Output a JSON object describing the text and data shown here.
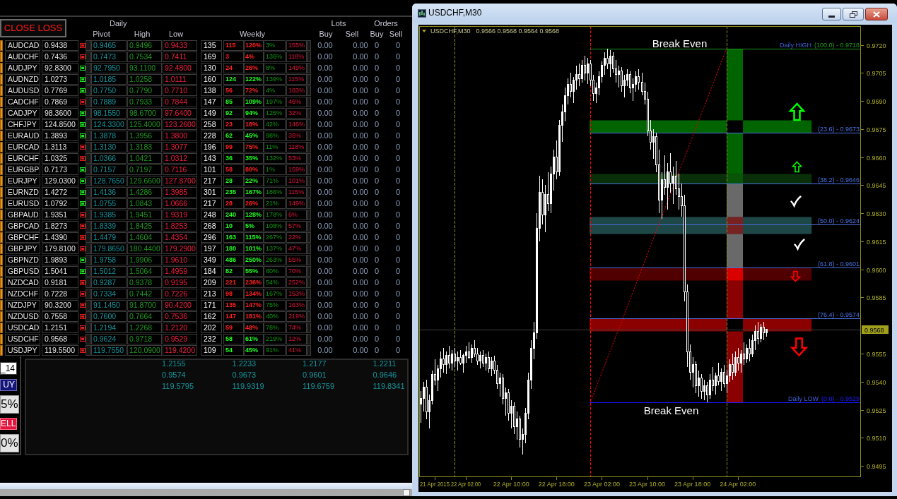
{
  "left_panel": {
    "close_loss_button": "CLOSE LOSS",
    "header": {
      "daily": "Daily",
      "pivot": "Pivot",
      "high": "High",
      "low": "Low",
      "weekly": "Weekly",
      "lots": "Lots",
      "orders": "Orders",
      "lots_buy": "Buy",
      "lots_sell": "Sell",
      "orders_buy": "Buy",
      "orders_sell": "Sell"
    },
    "rows": [
      {
        "symbol": "AUDCAD",
        "price": "0.9438",
        "signal": {
          "color": "#e01b1b"
        },
        "pivot": "0.9465",
        "high": "0.9496",
        "low": "0.9433",
        "weekly": {
          "values": [
            "135",
            "115",
            "120%",
            "3%",
            "155%"
          ],
          "color": "#ff2020"
        },
        "lots": [
          "0.00",
          "0.00"
        ],
        "orders": [
          "0",
          "0"
        ]
      },
      {
        "symbol": "AUDCHF",
        "price": "0.7436",
        "signal": {
          "color": "#e01b1b"
        },
        "pivot": "0.7473",
        "high": "0.7534",
        "low": "0.7411",
        "weekly": {
          "values": [
            "169",
            "3",
            "4%",
            "136%",
            "118%"
          ],
          "color": "#ff2020"
        },
        "lots": [
          "0.00",
          "0.00"
        ],
        "orders": [
          "0",
          "0"
        ]
      },
      {
        "symbol": "AUDJPY",
        "price": "92.8300",
        "signal": {
          "color": "#19e019"
        },
        "pivot": "92.7950",
        "high": "93.1100",
        "low": "92.4800",
        "weekly": {
          "values": [
            "130",
            "24",
            "26%",
            "8%",
            "149%"
          ],
          "color": "#ff2020"
        },
        "lots": [
          "0.00",
          "0.00"
        ],
        "orders": [
          "0",
          "0"
        ]
      },
      {
        "symbol": "AUDNZD",
        "price": "1.0273",
        "signal": {
          "color": "#19e019"
        },
        "pivot": "1.0185",
        "high": "1.0258",
        "low": "1.0111",
        "weekly": {
          "values": [
            "160",
            "124",
            "122%",
            "139%",
            "115%"
          ],
          "color": "#20ff20"
        },
        "lots": [
          "0.00",
          "0.00"
        ],
        "orders": [
          "0",
          "0"
        ]
      },
      {
        "symbol": "AUDUSD",
        "price": "0.7769",
        "signal": {
          "color": "#19e019"
        },
        "pivot": "0.7750",
        "high": "0.7790",
        "low": "0.7710",
        "weekly": {
          "values": [
            "138",
            "56",
            "72%",
            "4%",
            "183%"
          ],
          "color": "#ff2020"
        },
        "lots": [
          "0.00",
          "0.00"
        ],
        "orders": [
          "0",
          "0"
        ]
      },
      {
        "symbol": "CADCHF",
        "price": "0.7869",
        "signal": {
          "color": "#e01b1b"
        },
        "pivot": "0.7889",
        "high": "0.7933",
        "low": "0.7844",
        "weekly": {
          "values": [
            "147",
            "85",
            "109%",
            "197%",
            "46%"
          ],
          "color": "#20ff20"
        },
        "lots": [
          "0.00",
          "0.00"
        ],
        "orders": [
          "0",
          "0"
        ]
      },
      {
        "symbol": "CADJPY",
        "price": "98.3600",
        "signal": {
          "color": "#19e019"
        },
        "pivot": "98.1550",
        "high": "98.6700",
        "low": "97.6400",
        "weekly": {
          "values": [
            "149",
            "92",
            "94%",
            "126%",
            "32%"
          ],
          "color": "#20ff20"
        },
        "lots": [
          "0.00",
          "0.00"
        ],
        "orders": [
          "0",
          "0"
        ]
      },
      {
        "symbol": "CHFJPY",
        "price": "124.8500",
        "signal": {
          "color": "#19e019"
        },
        "pivot": "124.3300",
        "high": "125.4000",
        "low": "123.2600",
        "weekly": {
          "values": [
            "258",
            "23",
            "18%",
            "42%",
            "146%"
          ],
          "color": "#ff2020"
        },
        "lots": [
          "0.00",
          "0.00"
        ],
        "orders": [
          "0",
          "0"
        ]
      },
      {
        "symbol": "EURAUD",
        "price": "1.3893",
        "signal": {
          "color": "#19e019"
        },
        "pivot": "1.3878",
        "high": "1.3956",
        "low": "1.3800",
        "weekly": {
          "values": [
            "228",
            "62",
            "45%",
            "98%",
            "35%"
          ],
          "color": "#20ff20"
        },
        "lots": [
          "0.00",
          "0.00"
        ],
        "orders": [
          "0",
          "0"
        ]
      },
      {
        "symbol": "EURCAD",
        "price": "1.3113",
        "signal": {
          "color": "#e01b1b"
        },
        "pivot": "1.3130",
        "high": "1.3183",
        "low": "1.3077",
        "weekly": {
          "values": [
            "196",
            "99",
            "75%",
            "11%",
            "118%"
          ],
          "color": "#ff2020"
        },
        "lots": [
          "0.00",
          "0.00"
        ],
        "orders": [
          "0",
          "0"
        ]
      },
      {
        "symbol": "EURCHF",
        "price": "1.0325",
        "signal": {
          "color": "#e01b1b"
        },
        "pivot": "1.0366",
        "high": "1.0421",
        "low": "1.0312",
        "weekly": {
          "values": [
            "143",
            "36",
            "35%",
            "132%",
            "53%"
          ],
          "color": "#20ff20"
        },
        "lots": [
          "0.00",
          "0.00"
        ],
        "orders": [
          "0",
          "0"
        ]
      },
      {
        "symbol": "EURGBP",
        "price": "0.7173",
        "signal": {
          "color": "#19e019"
        },
        "pivot": "0.7157",
        "high": "0.7197",
        "low": "0.7116",
        "weekly": {
          "values": [
            "101",
            "58",
            "80%",
            "1%",
            "159%"
          ],
          "color": "#ff2020"
        },
        "lots": [
          "0.00",
          "0.00"
        ],
        "orders": [
          "0",
          "0"
        ]
      },
      {
        "symbol": "EURJPY",
        "price": "129.0300",
        "signal": {
          "color": "#19e019"
        },
        "pivot": "128.7650",
        "high": "129.6600",
        "low": "127.8700",
        "weekly": {
          "values": [
            "217",
            "28",
            "22%",
            "71%",
            "101%"
          ],
          "color": "#20ff20"
        },
        "lots": [
          "0.00",
          "0.00"
        ],
        "orders": [
          "0",
          "0"
        ]
      },
      {
        "symbol": "EURNZD",
        "price": "1.4272",
        "signal": {
          "color": "#19e019"
        },
        "pivot": "1.4136",
        "high": "1.4286",
        "low": "1.3985",
        "weekly": {
          "values": [
            "301",
            "235",
            "167%",
            "186%",
            "115%"
          ],
          "color": "#20ff20"
        },
        "lots": [
          "0.00",
          "0.00"
        ],
        "orders": [
          "0",
          "0"
        ]
      },
      {
        "symbol": "EURUSD",
        "price": "1.0792",
        "signal": {
          "color": "#19e019"
        },
        "pivot": "1.0755",
        "high": "1.0843",
        "low": "1.0666",
        "weekly": {
          "values": [
            "217",
            "28",
            "26%",
            "21%",
            "149%"
          ],
          "color": "#ff2020"
        },
        "lots": [
          "0.00",
          "0.00"
        ],
        "orders": [
          "0",
          "0"
        ]
      },
      {
        "symbol": "GBPAUD",
        "price": "1.9351",
        "signal": {
          "color": "#e01b1b"
        },
        "pivot": "1.9385",
        "high": "1.9451",
        "low": "1.9319",
        "weekly": {
          "values": [
            "248",
            "240",
            "128%",
            "178%",
            "6%"
          ],
          "color": "#20ff20"
        },
        "lots": [
          "0.00",
          "0.00"
        ],
        "orders": [
          "0",
          "0"
        ]
      },
      {
        "symbol": "GBPCAD",
        "price": "1.8273",
        "signal": {
          "color": "#e01b1b"
        },
        "pivot": "1.8339",
        "high": "1.8425",
        "low": "1.8253",
        "weekly": {
          "values": [
            "268",
            "10",
            "5%",
            "108%",
            "57%"
          ],
          "color": "#20ff20"
        },
        "lots": [
          "0.00",
          "0.00"
        ],
        "orders": [
          "0",
          "0"
        ]
      },
      {
        "symbol": "GBPCHF",
        "price": "1.4390",
        "signal": {
          "color": "#e01b1b"
        },
        "pivot": "1.4479",
        "high": "1.4604",
        "low": "1.4354",
        "weekly": {
          "values": [
            "296",
            "163",
            "115%",
            "267%",
            "22%"
          ],
          "color": "#20ff20"
        },
        "lots": [
          "0.00",
          "0.00"
        ],
        "orders": [
          "0",
          "0"
        ]
      },
      {
        "symbol": "GBPJPY",
        "price": "179.8100",
        "signal": {
          "color": "#e01b1b"
        },
        "pivot": "179.8650",
        "high": "180.4400",
        "low": "179.2900",
        "weekly": {
          "values": [
            "197",
            "180",
            "101%",
            "137%",
            "47%"
          ],
          "color": "#20ff20"
        },
        "lots": [
          "0.00",
          "0.00"
        ],
        "orders": [
          "0",
          "0"
        ]
      },
      {
        "symbol": "GBPNZD",
        "price": "1.9893",
        "signal": {
          "color": "#19e019"
        },
        "pivot": "1.9758",
        "high": "1.9906",
        "low": "1.9610",
        "weekly": {
          "values": [
            "349",
            "486",
            "250%",
            "263%",
            "55%"
          ],
          "color": "#20ff20"
        },
        "lots": [
          "0.00",
          "0.00"
        ],
        "orders": [
          "0",
          "0"
        ]
      },
      {
        "symbol": "GBPUSD",
        "price": "1.5041",
        "signal": {
          "color": "#19e019"
        },
        "pivot": "1.5012",
        "high": "1.5064",
        "low": "1.4959",
        "weekly": {
          "values": [
            "184",
            "82",
            "55%",
            "80%",
            "70%"
          ],
          "color": "#20ff20"
        },
        "lots": [
          "0.00",
          "0.00"
        ],
        "orders": [
          "0",
          "0"
        ]
      },
      {
        "symbol": "NZDCAD",
        "price": "0.9181",
        "signal": {
          "color": "#e01b1b"
        },
        "pivot": "0.9287",
        "high": "0.9378",
        "low": "0.9195",
        "weekly": {
          "values": [
            "209",
            "221",
            "236%",
            "54%",
            "252%"
          ],
          "color": "#ff2020"
        },
        "lots": [
          "0.00",
          "0.00"
        ],
        "orders": [
          "0",
          "0"
        ]
      },
      {
        "symbol": "NZDCHF",
        "price": "0.7228",
        "signal": {
          "color": "#e01b1b"
        },
        "pivot": "0.7334",
        "high": "0.7442",
        "low": "0.7226",
        "weekly": {
          "values": [
            "213",
            "98",
            "134%",
            "167%",
            "153%"
          ],
          "color": "#ff2020"
        },
        "lots": [
          "0.00",
          "0.00"
        ],
        "orders": [
          "0",
          "0"
        ]
      },
      {
        "symbol": "NZDJPY",
        "price": "90.3200",
        "signal": {
          "color": "#e01b1b"
        },
        "pivot": "91.1450",
        "high": "91.8700",
        "low": "90.4200",
        "weekly": {
          "values": [
            "171",
            "135",
            "147%",
            "75%",
            "163%"
          ],
          "color": "#ff2020"
        },
        "lots": [
          "0.00",
          "0.00"
        ],
        "orders": [
          "0",
          "0"
        ]
      },
      {
        "symbol": "NZDUSD",
        "price": "0.7558",
        "signal": {
          "color": "#e01b1b"
        },
        "pivot": "0.7600",
        "high": "0.7664",
        "low": "0.7536",
        "weekly": {
          "values": [
            "162",
            "147",
            "181%",
            "40%",
            "219%"
          ],
          "color": "#ff2020"
        },
        "lots": [
          "0.00",
          "0.00"
        ],
        "orders": [
          "0",
          "0"
        ]
      },
      {
        "symbol": "USDCAD",
        "price": "1.2151",
        "signal": {
          "color": "#e01b1b"
        },
        "pivot": "1.2194",
        "high": "1.2268",
        "low": "1.2120",
        "weekly": {
          "values": [
            "202",
            "59",
            "48%",
            "78%",
            "74%"
          ],
          "color": "#ff2020"
        },
        "lots": [
          "0.00",
          "0.00"
        ],
        "orders": [
          "0",
          "0"
        ]
      },
      {
        "symbol": "USDCHF",
        "price": "0.9568",
        "signal": {
          "color": "#e01b1b"
        },
        "pivot": "0.9624",
        "high": "0.9718",
        "low": "0.9529",
        "weekly": {
          "values": [
            "232",
            "58",
            "61%",
            "219%",
            "12%"
          ],
          "color": "#20ff20"
        },
        "lots": [
          "0.00",
          "0.00"
        ],
        "orders": [
          "0",
          "0"
        ]
      },
      {
        "symbol": "USDJPY",
        "price": "119.5500",
        "signal": {
          "color": "#e01b1b"
        },
        "pivot": "119.7550",
        "high": "120.0900",
        "low": "119.4200",
        "weekly": {
          "values": [
            "109",
            "54",
            "45%",
            "91%",
            "41%"
          ],
          "color": "#20ff20"
        },
        "lots": [
          "0.00",
          "0.00"
        ],
        "orders": [
          "0",
          "0"
        ]
      }
    ],
    "side_controls": [
      {
        "kind": "field",
        "text": "_14"
      },
      {
        "kind": "buy",
        "text": "UY"
      },
      {
        "kind": "percent",
        "text": "5%"
      },
      {
        "kind": "sell",
        "text": "ELL"
      },
      {
        "kind": "percent",
        "text": "0%"
      }
    ],
    "summary_rows": [
      [
        "1.2155",
        "1.2233",
        "1.2177",
        "1.2211"
      ],
      [
        "0.9574",
        "0.9673",
        "0.9601",
        "0.9646"
      ],
      [
        "119.5795",
        "119.9319",
        "119.6759",
        "119.8341"
      ]
    ]
  },
  "chart_window": {
    "title": "USDCHF,M30",
    "header": {
      "symbol": "USDCHF,M30",
      "quotes": "0.9566 0.9568 0.9564 0.9568"
    },
    "chart_data": [
      {
        "type": "candlestick",
        "xlim": [
          "2015-04-21T17:45",
          "2015-04-24T23:45"
        ],
        "ylim": [
          0.9489,
          0.973
        ],
        "x": [
          "2015-04-21T18:00",
          "2015-04-21T18:30",
          "2015-04-21T19:00",
          "2015-04-21T19:30",
          "2015-04-21T20:00",
          "2015-04-21T20:30",
          "2015-04-21T21:00",
          "2015-04-21T21:30",
          "2015-04-21T22:00",
          "2015-04-21T22:30",
          "2015-04-21T23:00",
          "2015-04-21T23:30",
          "2015-04-22T00:00",
          "2015-04-22T00:30",
          "2015-04-22T01:00",
          "2015-04-22T01:30",
          "2015-04-22T02:00",
          "2015-04-22T02:30",
          "2015-04-22T03:00",
          "2015-04-22T03:30",
          "2015-04-22T04:00",
          "2015-04-22T04:30",
          "2015-04-22T05:00",
          "2015-04-22T05:30",
          "2015-04-22T06:00",
          "2015-04-22T06:30",
          "2015-04-22T07:00",
          "2015-04-22T07:30",
          "2015-04-22T08:00",
          "2015-04-22T08:30",
          "2015-04-22T09:00",
          "2015-04-22T09:30",
          "2015-04-22T10:00",
          "2015-04-22T10:30",
          "2015-04-22T11:00",
          "2015-04-22T11:30",
          "2015-04-22T12:00",
          "2015-04-22T12:30",
          "2015-04-22T13:00",
          "2015-04-22T13:30",
          "2015-04-22T14:00",
          "2015-04-22T14:30",
          "2015-04-22T15:00",
          "2015-04-22T15:30",
          "2015-04-22T16:00",
          "2015-04-22T16:30",
          "2015-04-22T17:00",
          "2015-04-22T17:30",
          "2015-04-22T18:00",
          "2015-04-22T18:30",
          "2015-04-22T19:00",
          "2015-04-22T19:30",
          "2015-04-22T20:00",
          "2015-04-22T20:30",
          "2015-04-22T21:00",
          "2015-04-22T21:30",
          "2015-04-22T22:00",
          "2015-04-22T22:30",
          "2015-04-22T23:00",
          "2015-04-22T23:30",
          "2015-04-23T00:00",
          "2015-04-23T00:30",
          "2015-04-23T01:00",
          "2015-04-23T01:30",
          "2015-04-23T02:00",
          "2015-04-23T02:30",
          "2015-04-23T03:00",
          "2015-04-23T03:30",
          "2015-04-23T04:00",
          "2015-04-23T04:30",
          "2015-04-23T05:00",
          "2015-04-23T05:30",
          "2015-04-23T06:00",
          "2015-04-23T06:30",
          "2015-04-23T07:00",
          "2015-04-23T07:30",
          "2015-04-23T08:00",
          "2015-04-23T08:30",
          "2015-04-23T09:00",
          "2015-04-23T09:30",
          "2015-04-23T10:00",
          "2015-04-23T10:30",
          "2015-04-23T11:00",
          "2015-04-23T11:30",
          "2015-04-23T12:00",
          "2015-04-23T12:30",
          "2015-04-23T13:00",
          "2015-04-23T13:30",
          "2015-04-23T14:00",
          "2015-04-23T14:30",
          "2015-04-23T15:00",
          "2015-04-23T15:30",
          "2015-04-23T16:00",
          "2015-04-23T16:30",
          "2015-04-23T17:00",
          "2015-04-23T17:30",
          "2015-04-23T18:00",
          "2015-04-23T18:30",
          "2015-04-23T19:00",
          "2015-04-23T19:30",
          "2015-04-23T20:00",
          "2015-04-23T20:30",
          "2015-04-23T21:00",
          "2015-04-23T21:30",
          "2015-04-23T22:00",
          "2015-04-23T22:30",
          "2015-04-23T23:00",
          "2015-04-23T23:30",
          "2015-04-24T00:00",
          "2015-04-24T00:30",
          "2015-04-24T01:00",
          "2015-04-24T01:30",
          "2015-04-24T02:00",
          "2015-04-24T02:30",
          "2015-04-24T03:00",
          "2015-04-24T03:30",
          "2015-04-24T04:00",
          "2015-04-24T04:30",
          "2015-04-24T05:00",
          "2015-04-24T05:30",
          "2015-04-24T06:00",
          "2015-04-24T06:30",
          "2015-04-24T07:00"
        ],
        "ohlc": [
          [
            0.9528,
            0.9535,
            0.9518,
            0.9531
          ],
          [
            0.9531,
            0.954,
            0.9524,
            0.9537
          ],
          [
            0.9537,
            0.9541,
            0.952,
            0.9524
          ],
          [
            0.9524,
            0.9533,
            0.9515,
            0.953
          ],
          [
            0.953,
            0.9546,
            0.9528,
            0.9544
          ],
          [
            0.9544,
            0.9552,
            0.9538,
            0.9541
          ],
          [
            0.9541,
            0.9549,
            0.9535,
            0.9547
          ],
          [
            0.9547,
            0.9556,
            0.9542,
            0.9552
          ],
          [
            0.9552,
            0.9558,
            0.9545,
            0.9549
          ],
          [
            0.9549,
            0.9556,
            0.9544,
            0.9554
          ],
          [
            0.9554,
            0.9559,
            0.9547,
            0.955
          ],
          [
            0.955,
            0.9557,
            0.9546,
            0.9555
          ],
          [
            0.9555,
            0.9558,
            0.9548,
            0.9551
          ],
          [
            0.9551,
            0.9556,
            0.9546,
            0.9553
          ],
          [
            0.9553,
            0.9557,
            0.9549,
            0.955
          ],
          [
            0.955,
            0.9555,
            0.9545,
            0.9554
          ],
          [
            0.9554,
            0.9559,
            0.955,
            0.9556
          ],
          [
            0.9556,
            0.9561,
            0.9552,
            0.9553
          ],
          [
            0.9553,
            0.956,
            0.955,
            0.9558
          ],
          [
            0.9558,
            0.9562,
            0.9553,
            0.9555
          ],
          [
            0.9555,
            0.9558,
            0.9549,
            0.9551
          ],
          [
            0.9551,
            0.9556,
            0.9547,
            0.9554
          ],
          [
            0.9554,
            0.9557,
            0.9548,
            0.955
          ],
          [
            0.955,
            0.9555,
            0.9546,
            0.9553
          ],
          [
            0.9553,
            0.9556,
            0.9545,
            0.9547
          ],
          [
            0.9547,
            0.9553,
            0.9543,
            0.9551
          ],
          [
            0.9551,
            0.9554,
            0.9544,
            0.9546
          ],
          [
            0.9546,
            0.9549,
            0.9536,
            0.9539
          ],
          [
            0.9539,
            0.9545,
            0.9532,
            0.9542
          ],
          [
            0.9542,
            0.9544,
            0.9528,
            0.9531
          ],
          [
            0.9531,
            0.9537,
            0.9522,
            0.9534
          ],
          [
            0.9534,
            0.9536,
            0.9519,
            0.9523
          ],
          [
            0.9523,
            0.953,
            0.9515,
            0.9527
          ],
          [
            0.9527,
            0.9529,
            0.9512,
            0.9516
          ],
          [
            0.9516,
            0.9524,
            0.9509,
            0.952
          ],
          [
            0.952,
            0.9522,
            0.9505,
            0.9509
          ],
          [
            0.9509,
            0.9515,
            0.9501,
            0.9512
          ],
          [
            0.9512,
            0.9526,
            0.9507,
            0.9523
          ],
          [
            0.9523,
            0.9545,
            0.952,
            0.9541
          ],
          [
            0.9541,
            0.9562,
            0.9536,
            0.9558
          ],
          [
            0.9558,
            0.9572,
            0.9552,
            0.9566
          ],
          [
            0.9566,
            0.963,
            0.9563,
            0.9622
          ],
          [
            0.9622,
            0.965,
            0.9615,
            0.9641
          ],
          [
            0.9641,
            0.9648,
            0.9624,
            0.9629
          ],
          [
            0.9629,
            0.9645,
            0.962,
            0.964
          ],
          [
            0.964,
            0.9652,
            0.9631,
            0.9635
          ],
          [
            0.9635,
            0.9655,
            0.963,
            0.9651
          ],
          [
            0.9651,
            0.9664,
            0.9642,
            0.966
          ],
          [
            0.966,
            0.9669,
            0.9648,
            0.9652
          ],
          [
            0.9652,
            0.968,
            0.965,
            0.9677
          ],
          [
            0.9677,
            0.9688,
            0.9668,
            0.9684
          ],
          [
            0.9684,
            0.9697,
            0.9679,
            0.9693
          ],
          [
            0.9693,
            0.9702,
            0.9688,
            0.9699
          ],
          [
            0.9699,
            0.9705,
            0.9692,
            0.9695
          ],
          [
            0.9695,
            0.9703,
            0.9689,
            0.9701
          ],
          [
            0.9701,
            0.9709,
            0.9696,
            0.9704
          ],
          [
            0.9704,
            0.971,
            0.9698,
            0.9702
          ],
          [
            0.9702,
            0.9712,
            0.97,
            0.9709
          ],
          [
            0.9709,
            0.9714,
            0.9701,
            0.9705
          ],
          [
            0.9705,
            0.9713,
            0.9699,
            0.971
          ],
          [
            0.971,
            0.9712,
            0.9698,
            0.9701
          ],
          [
            0.9701,
            0.9704,
            0.969,
            0.9694
          ],
          [
            0.9694,
            0.97,
            0.9689,
            0.9697
          ],
          [
            0.9697,
            0.9706,
            0.9693,
            0.9703
          ],
          [
            0.9703,
            0.9711,
            0.97,
            0.9709
          ],
          [
            0.9709,
            0.9716,
            0.9704,
            0.9713
          ],
          [
            0.9713,
            0.9718,
            0.9707,
            0.971
          ],
          [
            0.971,
            0.9717,
            0.9703,
            0.9714
          ],
          [
            0.9714,
            0.9716,
            0.9705,
            0.9707
          ],
          [
            0.9707,
            0.9712,
            0.97,
            0.9704
          ],
          [
            0.9704,
            0.9709,
            0.9697,
            0.9706
          ],
          [
            0.9706,
            0.9708,
            0.9695,
            0.9698
          ],
          [
            0.9698,
            0.9704,
            0.9692,
            0.9701
          ],
          [
            0.9701,
            0.9707,
            0.9698,
            0.9704
          ],
          [
            0.9704,
            0.9706,
            0.9694,
            0.9697
          ],
          [
            0.9697,
            0.9702,
            0.969,
            0.9699
          ],
          [
            0.9699,
            0.9706,
            0.9695,
            0.9703
          ],
          [
            0.9703,
            0.9707,
            0.9696,
            0.97
          ],
          [
            0.97,
            0.9705,
            0.9693,
            0.9695
          ],
          [
            0.9695,
            0.97,
            0.9688,
            0.9691
          ],
          [
            0.9691,
            0.9695,
            0.9671,
            0.9674
          ],
          [
            0.9674,
            0.968,
            0.9664,
            0.9668
          ],
          [
            0.9668,
            0.9675,
            0.9659,
            0.9671
          ],
          [
            0.9671,
            0.9673,
            0.9652,
            0.9656
          ],
          [
            0.9656,
            0.9664,
            0.963,
            0.9637
          ],
          [
            0.9637,
            0.9652,
            0.9627,
            0.9648
          ],
          [
            0.9648,
            0.9661,
            0.964,
            0.9644
          ],
          [
            0.9644,
            0.9657,
            0.9632,
            0.9652
          ],
          [
            0.9652,
            0.9662,
            0.9641,
            0.9646
          ],
          [
            0.9646,
            0.9655,
            0.9635,
            0.965
          ],
          [
            0.965,
            0.9658,
            0.964,
            0.9643
          ],
          [
            0.9643,
            0.9651,
            0.9632,
            0.9639
          ],
          [
            0.9639,
            0.9646,
            0.9628,
            0.9634
          ],
          [
            0.9634,
            0.964,
            0.9583,
            0.9588
          ],
          [
            0.9588,
            0.9592,
            0.9548,
            0.9556
          ],
          [
            0.9556,
            0.956,
            0.9541,
            0.9545
          ],
          [
            0.9545,
            0.9553,
            0.9537,
            0.9549
          ],
          [
            0.9549,
            0.9551,
            0.9534,
            0.9538
          ],
          [
            0.9538,
            0.9546,
            0.9532,
            0.9542
          ],
          [
            0.9542,
            0.9544,
            0.9531,
            0.9535
          ],
          [
            0.9535,
            0.9541,
            0.953,
            0.9538
          ],
          [
            0.9538,
            0.954,
            0.9529,
            0.9533
          ],
          [
            0.9533,
            0.9544,
            0.9531,
            0.9541
          ],
          [
            0.9541,
            0.9548,
            0.9535,
            0.9538
          ],
          [
            0.9538,
            0.9545,
            0.9533,
            0.9543
          ],
          [
            0.9543,
            0.955,
            0.9538,
            0.954
          ],
          [
            0.954,
            0.9547,
            0.9535,
            0.9545
          ],
          [
            0.9545,
            0.9549,
            0.9537,
            0.9539
          ],
          [
            0.9539,
            0.9546,
            0.9534,
            0.9543
          ],
          [
            0.9543,
            0.9552,
            0.954,
            0.9549
          ],
          [
            0.9549,
            0.9555,
            0.9541,
            0.9545
          ],
          [
            0.9545,
            0.9556,
            0.9543,
            0.9553
          ],
          [
            0.9553,
            0.9558,
            0.9546,
            0.955
          ],
          [
            0.955,
            0.9557,
            0.9545,
            0.9555
          ],
          [
            0.9555,
            0.9561,
            0.9549,
            0.9552
          ],
          [
            0.9552,
            0.956,
            0.955,
            0.9558
          ],
          [
            0.9558,
            0.9563,
            0.9551,
            0.9555
          ],
          [
            0.9555,
            0.9565,
            0.9553,
            0.9562
          ],
          [
            0.9562,
            0.957,
            0.9557,
            0.9567
          ],
          [
            0.9567,
            0.9572,
            0.956,
            0.9563
          ],
          [
            0.9563,
            0.9571,
            0.9561,
            0.9569
          ],
          [
            0.9569,
            0.9572,
            0.9562,
            0.9566
          ],
          [
            0.9566,
            0.9568,
            0.9564,
            0.9568
          ]
        ],
        "series": [
          {
            "type": "line",
            "x": [
              "2015-04-23T00:00",
              "2015-04-24T00:00"
            ],
            "values": [
              0.9529,
              0.9718
            ],
            "color": "#ff0000",
            "line_style": "dotted"
          }
        ],
        "yticks": [
          {
            "value": 0.972,
            "label": "0.9720"
          },
          {
            "value": 0.9705,
            "label": "0.9705"
          },
          {
            "value": 0.969,
            "label": "0.9690"
          },
          {
            "value": 0.9675,
            "label": "0.9675"
          },
          {
            "value": 0.966,
            "label": "0.9660"
          },
          {
            "value": 0.9645,
            "label": "0.9645"
          },
          {
            "value": 0.963,
            "label": "0.9630"
          },
          {
            "value": 0.9615,
            "label": "0.9615"
          },
          {
            "value": 0.96,
            "label": "0.9600"
          },
          {
            "value": 0.9585,
            "label": "0.9585"
          },
          {
            "value": 0.9555,
            "label": "0.9555"
          },
          {
            "value": 0.954,
            "label": "0.9540"
          },
          {
            "value": 0.9525,
            "label": "0.9525"
          },
          {
            "value": 0.951,
            "label": "0.9510"
          },
          {
            "value": 0.9495,
            "label": "0.9495"
          }
        ],
        "xticks": [
          {
            "value": "2015-04-21T20:30",
            "label": "21 Apr 2015"
          },
          {
            "value": "2015-04-22T02:00",
            "label": "22 Apr 02:00"
          },
          {
            "value": "2015-04-22T10:00",
            "label": "22 Apr 10:00"
          },
          {
            "value": "2015-04-22T18:00",
            "label": "22 Apr 18:00"
          },
          {
            "value": "2015-04-23T02:00",
            "label": "23 Apr 02:00"
          },
          {
            "value": "2015-04-23T10:00",
            "label": "23 Apr 10:00"
          },
          {
            "value": "2015-04-23T18:00",
            "label": "23 Apr 18:00"
          },
          {
            "value": "2015-04-24T02:00",
            "label": "24 Apr 02:00"
          }
        ],
        "ref_lines": [
          {
            "axis": "x",
            "value": "2015-04-22T00:00",
            "color": "#8c8c1c",
            "line_style": "dashed"
          },
          {
            "axis": "x",
            "value": "2015-04-23T00:00",
            "color": "#ff0000",
            "line_style": "dashed"
          },
          {
            "axis": "x",
            "value": "2015-04-24T00:00",
            "color": "#8c8c1c",
            "line_style": "dashed"
          },
          {
            "axis": "y",
            "value": 0.9718,
            "color": "#1f9a1f"
          },
          {
            "axis": "y",
            "value": 0.9673,
            "color": "#4a70e0"
          },
          {
            "axis": "y",
            "value": 0.9646,
            "color": "#4a70e0"
          },
          {
            "axis": "y",
            "value": 0.9624,
            "color": "#4a70e0"
          },
          {
            "axis": "y",
            "value": 0.9601,
            "color": "#4a70e0"
          },
          {
            "axis": "y",
            "value": 0.9574,
            "color": "#4a70e0"
          },
          {
            "axis": "y",
            "value": 0.9529,
            "color": "#1a1aff"
          },
          {
            "axis": "y",
            "value": 0.9568,
            "label": "0.9568",
            "color": "#404040"
          }
        ],
        "annotations": [
          "Daily HIGH",
          "(100.0) - 0.9718",
          "(23.6) - 0.9673",
          "(38.2) - 0.9646",
          "(50.0) - 0.9624",
          "(61.8) - 0.9601",
          "(76.4) - 0.9574",
          "Daily LOW",
          "(0.0) - 0.9529",
          "Break Even",
          "Break Even"
        ]
      }
    ]
  }
}
